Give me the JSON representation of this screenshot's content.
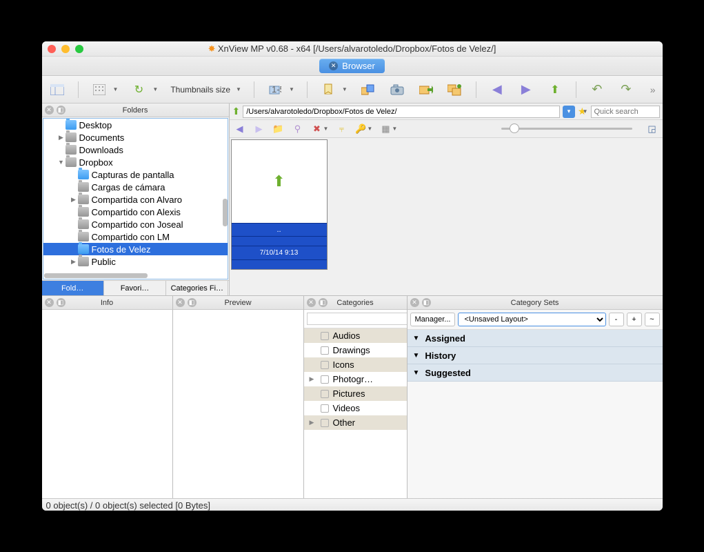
{
  "window": {
    "title": "XnView MP v0.68 - x64 [/Users/alvarotoledo/Dropbox/Fotos de Velez/]",
    "tab_label": "Browser"
  },
  "toolbar": {
    "thumbnails_size_label": "Thumbnails size"
  },
  "folders": {
    "title": "Folders",
    "tabs": [
      "Fold…",
      "Favori…",
      "Categories Fi…"
    ],
    "tree": [
      {
        "level": 1,
        "name": "Desktop",
        "color": "blue",
        "disc": ""
      },
      {
        "level": 1,
        "name": "Documents",
        "color": "gray",
        "disc": "▶"
      },
      {
        "level": 1,
        "name": "Downloads",
        "color": "gray",
        "disc": ""
      },
      {
        "level": 1,
        "name": "Dropbox",
        "color": "gray",
        "disc": "▼"
      },
      {
        "level": 2,
        "name": "Capturas de pantalla",
        "color": "blue",
        "disc": ""
      },
      {
        "level": 2,
        "name": "Cargas de cámara",
        "color": "gray",
        "disc": ""
      },
      {
        "level": 2,
        "name": "Compartida con Alvaro",
        "color": "gray",
        "disc": "▶"
      },
      {
        "level": 2,
        "name": "Compartido con Alexis",
        "color": "gray",
        "disc": ""
      },
      {
        "level": 2,
        "name": "Compartido con Joseal",
        "color": "gray",
        "disc": ""
      },
      {
        "level": 2,
        "name": "Compartido con LM",
        "color": "gray",
        "disc": ""
      },
      {
        "level": 2,
        "name": "Fotos de Velez",
        "color": "blue",
        "disc": "",
        "selected": true
      },
      {
        "level": 2,
        "name": "Public",
        "color": "gray",
        "disc": "▶"
      }
    ]
  },
  "address": {
    "path": "/Users/alvarotoledo/Dropbox/Fotos de Velez/",
    "search_placeholder": "Quick search"
  },
  "thumb": {
    "name": "..",
    "date": "7/10/14 9:13"
  },
  "panels": {
    "info_title": "Info",
    "preview_title": "Preview",
    "categories_title": "Categories",
    "sets_title": "Category Sets"
  },
  "categories": {
    "filter_more": "...",
    "items": [
      "Audios",
      "Drawings",
      "Icons",
      "Photogr…",
      "Pictures",
      "Videos",
      "Other"
    ]
  },
  "sets": {
    "manager_label": "Manager...",
    "layout_value": "<Unsaved Layout>",
    "minus": "-",
    "plus": "+",
    "reset": "~",
    "sections": [
      "Assigned",
      "History",
      "Suggested"
    ]
  },
  "status": "0 object(s) / 0 object(s) selected [0 Bytes]"
}
